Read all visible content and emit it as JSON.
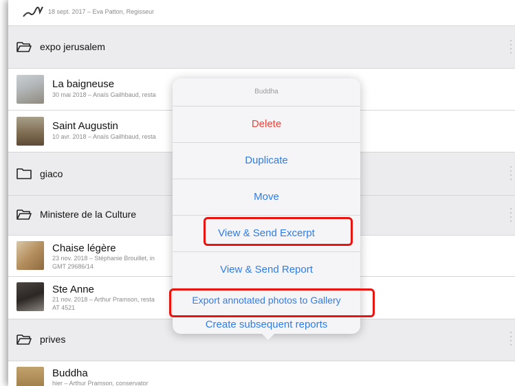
{
  "list": {
    "top_item": {
      "subtitle": "18 sept. 2017 – Eva Patton, Regisseur"
    },
    "folders": [
      {
        "name": "expo jerusalem"
      },
      {
        "name": "giaco"
      },
      {
        "name": "Ministere de la Culture"
      },
      {
        "name": "prives"
      }
    ],
    "items": [
      {
        "title": "La baigneuse",
        "subtitle": "30 mai 2018 – Anaïs Gailhbaud, resta"
      },
      {
        "title": "Saint Augustin",
        "subtitle": "10 avr. 2018 – Anaïs Gailhbaud, resta"
      },
      {
        "title": "Chaise légère",
        "subtitle": "23 nov. 2018 – Stéphanie Brouillet, in",
        "subtitle2": "GMT 29686/14"
      },
      {
        "title": "Ste Anne",
        "subtitle": "21 nov. 2018 – Arthur Pramson, resta",
        "subtitle2": "AT 4521"
      },
      {
        "title": "Buddha",
        "subtitle": "hier – Arthur Pramson, conservator"
      }
    ]
  },
  "popover": {
    "title": "Buddha",
    "actions": [
      {
        "label": "Delete"
      },
      {
        "label": "Duplicate"
      },
      {
        "label": "Move"
      },
      {
        "label": "View & Send Excerpt"
      },
      {
        "label": "View & Send Report"
      },
      {
        "label": "Export annotated photos to Gallery"
      },
      {
        "label": "Create subsequent reports"
      }
    ]
  },
  "colors": {
    "accent": "#2f7ce8",
    "destructive": "#e8453c",
    "highlight": "#e8140f",
    "folder_bg": "#ececee"
  },
  "icons": [
    "signature-icon",
    "folder-open-icon",
    "folder-icon",
    "more-dots-icon"
  ]
}
